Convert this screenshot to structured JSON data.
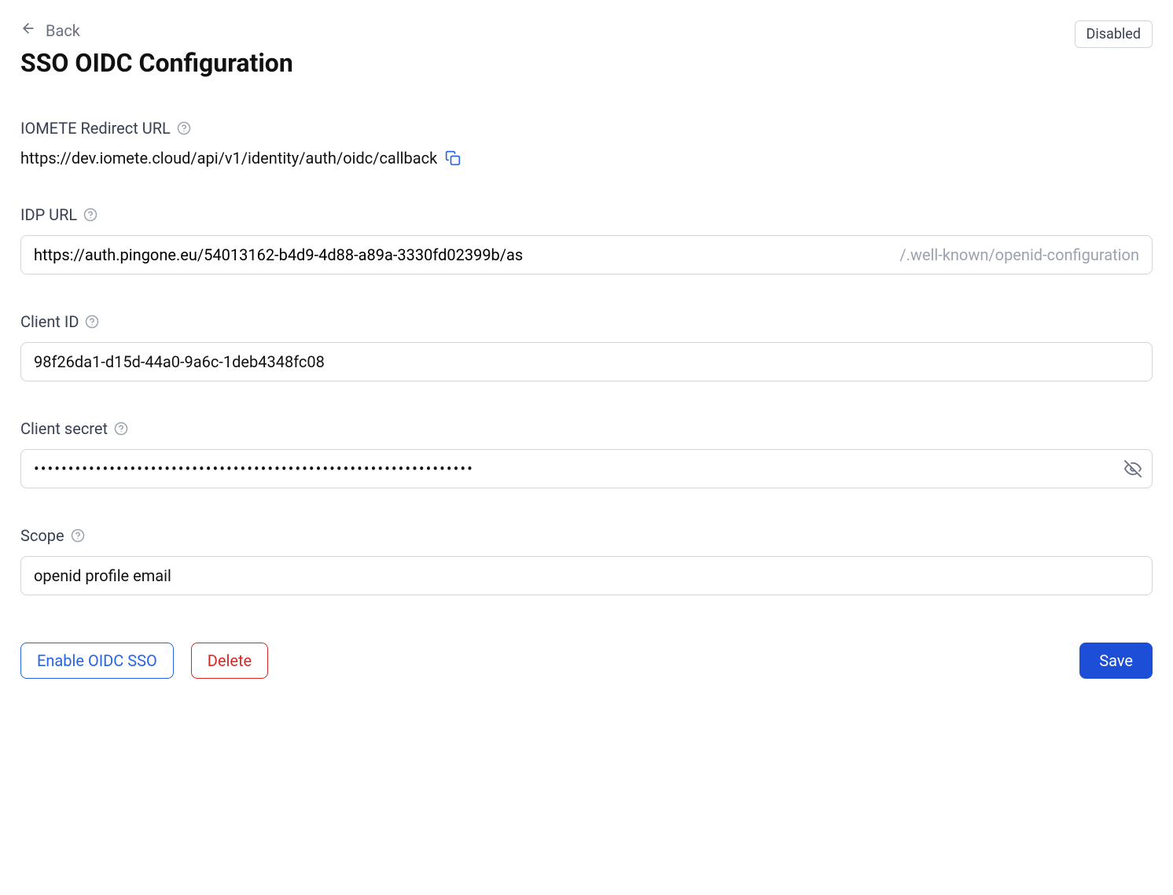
{
  "nav": {
    "back_label": "Back"
  },
  "page": {
    "title": "SSO OIDC Configuration",
    "status": "Disabled"
  },
  "redirect": {
    "label": "IOMETE Redirect URL",
    "url": "https://dev.iomete.cloud/api/v1/identity/auth/oidc/callback"
  },
  "idp": {
    "label": "IDP URL",
    "value": "https://auth.pingone.eu/54013162-b4d9-4d88-a89a-3330fd02399b/as",
    "suffix": "/.well-known/openid-configuration"
  },
  "client_id": {
    "label": "Client ID",
    "value": "98f26da1-d15d-44a0-9a6c-1deb4348fc08"
  },
  "client_secret": {
    "label": "Client secret",
    "value": "••••••••••••••••••••••••••••••••••••••••••••••••••••••••••••••••"
  },
  "scope": {
    "label": "Scope",
    "value": "openid profile email"
  },
  "buttons": {
    "enable": "Enable OIDC SSO",
    "delete": "Delete",
    "save": "Save"
  }
}
